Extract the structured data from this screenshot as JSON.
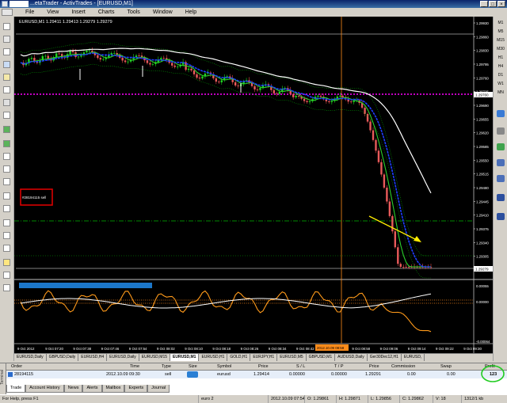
{
  "window": {
    "title": "...etaTrader - ActivTrades - [EURUSD,M1]"
  },
  "menu": [
    "File",
    "View",
    "Insert",
    "Charts",
    "Tools",
    "Window",
    "Help"
  ],
  "timeframes": [
    "M1",
    "M5",
    "M15",
    "M30",
    "H1",
    "H4",
    "D1",
    "W1",
    "MN"
  ],
  "chart": {
    "header": "EURUSD,M1  1.29411 1.29413 1.29279 1.29279",
    "price_labels": [
      "1.29930",
      "1.29860",
      "1.29830",
      "1.29795",
      "1.29760",
      "1.29725",
      "1.29690",
      "1.29655",
      "1.29620",
      "1.29585",
      "1.29550",
      "1.29515",
      "1.29480",
      "1.29445",
      "1.29410",
      "1.29375",
      "1.29340",
      "1.29305",
      "1.29279"
    ],
    "current_price": "1.29279",
    "magenta_line_label": "1.29760",
    "order_label": "#28194115 sell",
    "osc_labels": [
      "0.00055",
      "0.00000",
      "-0.00064"
    ],
    "time_labels": [
      "9 Oct 2012",
      "9 Oct 07:20",
      "9 Oct 07:38",
      "9 Oct 07:46",
      "9 Oct 07:54",
      "9 Oct 08:02",
      "9 Oct 08:10",
      "9 Oct 08:18",
      "9 Oct 08:26",
      "9 Oct 08:34",
      "9 Oct 08:42",
      "9 Oct 08:50",
      "9 Oct 08:58",
      "9 Oct 09:06",
      "9 Oct 09:14",
      "9 Oct 09:22",
      "9 Oct 09:30"
    ],
    "highlight_time": "2012.10.09 08:58",
    "colors": {
      "bg": "#000000",
      "magenta": "#ff00ff",
      "green_dash": "#00b400",
      "blue_ma": "#1f3fff",
      "white_ma": "#ffffff",
      "osc_orange": "#ff9a1a",
      "vline": "#ff8c1a",
      "red_box": "#e60000",
      "arrow": "#ffee00"
    }
  },
  "sheet_tabs": [
    "EURUSD,Daily",
    "GBPUSD,Daily",
    "EURUSD,H4",
    "EURUSD,Daily",
    "EURUSD,M15",
    "EURUSD,M1",
    "EURUSD,H1",
    "GOLD,H1",
    "EURJPY,H1",
    "EURUSD,M5",
    "GBPUSD,M1",
    "AUDUSD,Daily",
    "Ger30Dec12,H1",
    "EURUSD,"
  ],
  "terminal": {
    "side_label": "Terminal",
    "columns": [
      "Order",
      "Time",
      "Type",
      "Size",
      "Symbol",
      "Price",
      "S / L",
      "T / P",
      "Price",
      "Commission",
      "Swap",
      "Profit"
    ],
    "row": {
      "order": "28194115",
      "time": "2012.10.09 09:30",
      "type": "sell",
      "size": "",
      "symbol": "eurusd",
      "price": "1.29414",
      "sl": "0.00000",
      "tp": "0.00000",
      "price2": "1.29291",
      "commission": "0.00",
      "swap": "0.00",
      "profit": "123"
    },
    "tabs": [
      "Trade",
      "Account History",
      "News",
      "Alerts",
      "Mailbox",
      "Experts",
      "Journal"
    ]
  },
  "status": {
    "help": "For Help, press F1",
    "profile": "euro 2",
    "datetime": "2012.10.09 07:54",
    "o": "O: 1.29861",
    "h": "H: 1.29871",
    "l": "L: 1.29856",
    "c": "C: 1.29862",
    "v": "V: 18",
    "traffic": "1312/1 kb"
  }
}
